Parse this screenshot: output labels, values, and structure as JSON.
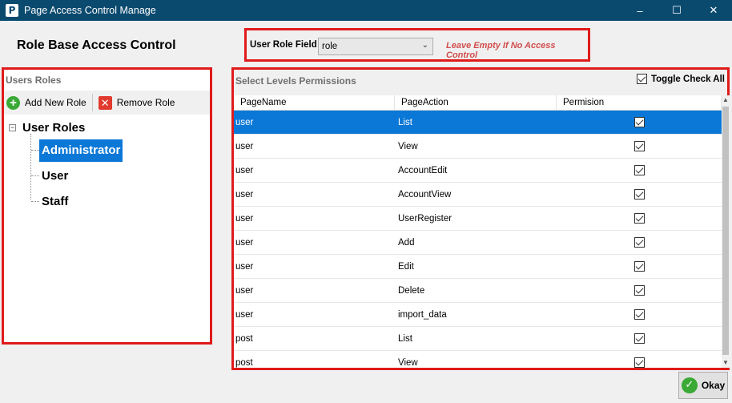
{
  "window": {
    "app_icon": "P",
    "title": "Page Access Control Manage",
    "minimize": "–",
    "maximize": "☐",
    "close": "✕"
  },
  "header": {
    "title": "Role Base Access Control",
    "role_field_label": "User Role Field",
    "role_field_value": "role",
    "role_field_hint": "Leave Empty If No Access Control"
  },
  "users_roles": {
    "header": "Users Roles",
    "add_label": "Add New Role",
    "remove_label": "Remove Role",
    "tree_root": "User Roles",
    "roles": [
      "Administrator",
      "User",
      "Staff"
    ],
    "selected_role": "Administrator"
  },
  "permissions": {
    "header": "Select Levels Permissions",
    "toggle_all_label": "Toggle Check All",
    "columns": [
      "PageName",
      "PageAction",
      "Permision"
    ],
    "rows": [
      {
        "page": "user",
        "action": "List",
        "checked": true
      },
      {
        "page": "user",
        "action": "View",
        "checked": true
      },
      {
        "page": "user",
        "action": "AccountEdit",
        "checked": true
      },
      {
        "page": "user",
        "action": "AccountView",
        "checked": true
      },
      {
        "page": "user",
        "action": "UserRegister",
        "checked": true
      },
      {
        "page": "user",
        "action": "Add",
        "checked": true
      },
      {
        "page": "user",
        "action": "Edit",
        "checked": true
      },
      {
        "page": "user",
        "action": "Delete",
        "checked": true
      },
      {
        "page": "user",
        "action": "import_data",
        "checked": true
      },
      {
        "page": "post",
        "action": "List",
        "checked": true
      },
      {
        "page": "post",
        "action": "View",
        "checked": true
      }
    ]
  },
  "footer": {
    "okay_label": "Okay"
  },
  "colors": {
    "titlebar": "#0b4a6f",
    "highlight": "#e01b1b",
    "selection": "#0b78d7"
  }
}
